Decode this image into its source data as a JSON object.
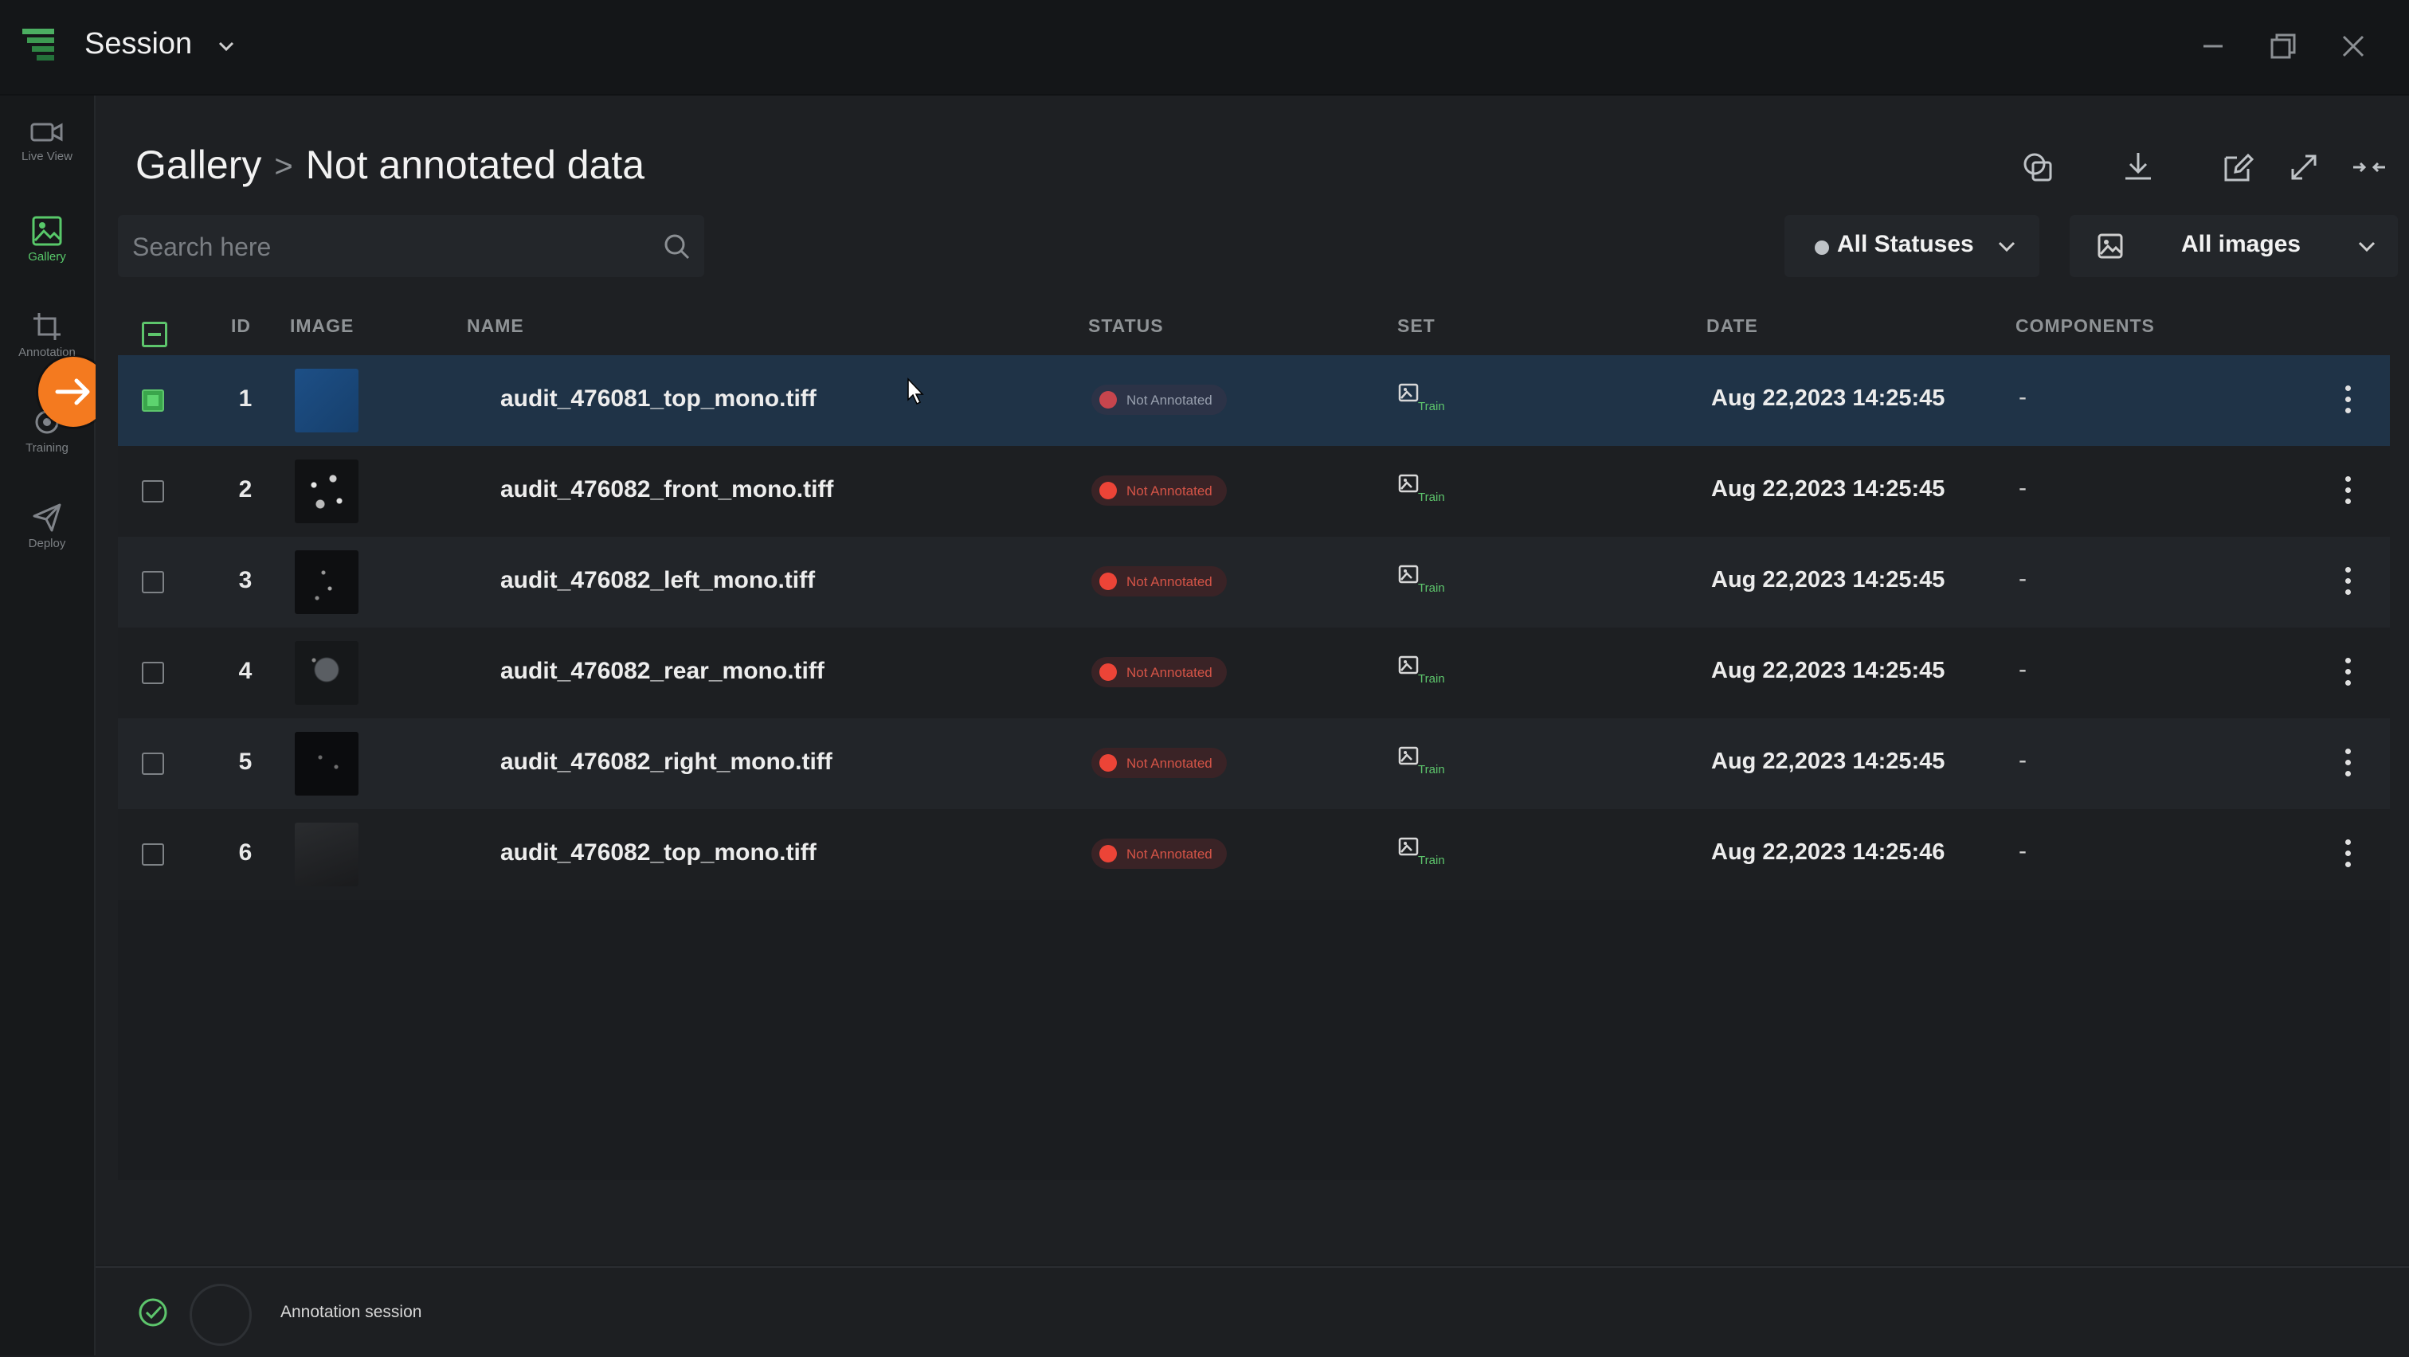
{
  "app": {
    "title": "Session"
  },
  "sidebar": {
    "items": [
      {
        "label": "Live View",
        "icon": "video-camera-icon"
      },
      {
        "label": "Gallery",
        "icon": "image-icon",
        "active": true
      },
      {
        "label": "Annotation",
        "icon": "crop-icon"
      },
      {
        "label": "Training",
        "icon": "training-icon"
      },
      {
        "label": "Deploy",
        "icon": "send-icon"
      }
    ]
  },
  "breadcrumb": {
    "root": "Gallery",
    "separator": ">",
    "current": "Not annotated data"
  },
  "search": {
    "placeholder": "Search here",
    "value": ""
  },
  "filters": {
    "status_label": "All Statuses",
    "images_label": "All images"
  },
  "table": {
    "columns": [
      "ID",
      "IMAGE",
      "NAME",
      "STATUS",
      "SET",
      "DATE",
      "COMPONENTS"
    ],
    "rows": [
      {
        "id": "1",
        "name": "audit_476081_top_mono.tiff",
        "status": "Not Annotated",
        "set": "Train",
        "date": "Aug 22,2023 14:25:45",
        "components": "-",
        "checked": true
      },
      {
        "id": "2",
        "name": "audit_476082_front_mono.tiff",
        "status": "Not Annotated",
        "set": "Train",
        "date": "Aug 22,2023 14:25:45",
        "components": "-",
        "checked": false
      },
      {
        "id": "3",
        "name": "audit_476082_left_mono.tiff",
        "status": "Not Annotated",
        "set": "Train",
        "date": "Aug 22,2023 14:25:45",
        "components": "-",
        "checked": false
      },
      {
        "id": "4",
        "name": "audit_476082_rear_mono.tiff",
        "status": "Not Annotated",
        "set": "Train",
        "date": "Aug 22,2023 14:25:45",
        "components": "-",
        "checked": false
      },
      {
        "id": "5",
        "name": "audit_476082_right_mono.tiff",
        "status": "Not Annotated",
        "set": "Train",
        "date": "Aug 22,2023 14:25:45",
        "components": "-",
        "checked": false
      },
      {
        "id": "6",
        "name": "audit_476082_top_mono.tiff",
        "status": "Not Annotated",
        "set": "Train",
        "date": "Aug 22,2023 14:25:46",
        "components": "-",
        "checked": false
      }
    ]
  },
  "footer": {
    "label": "Annotation session"
  },
  "colors": {
    "accent": "#5dc56c",
    "fab": "#f47a1f",
    "status_red": "#ec4437",
    "selected_row": "#1f3347"
  }
}
